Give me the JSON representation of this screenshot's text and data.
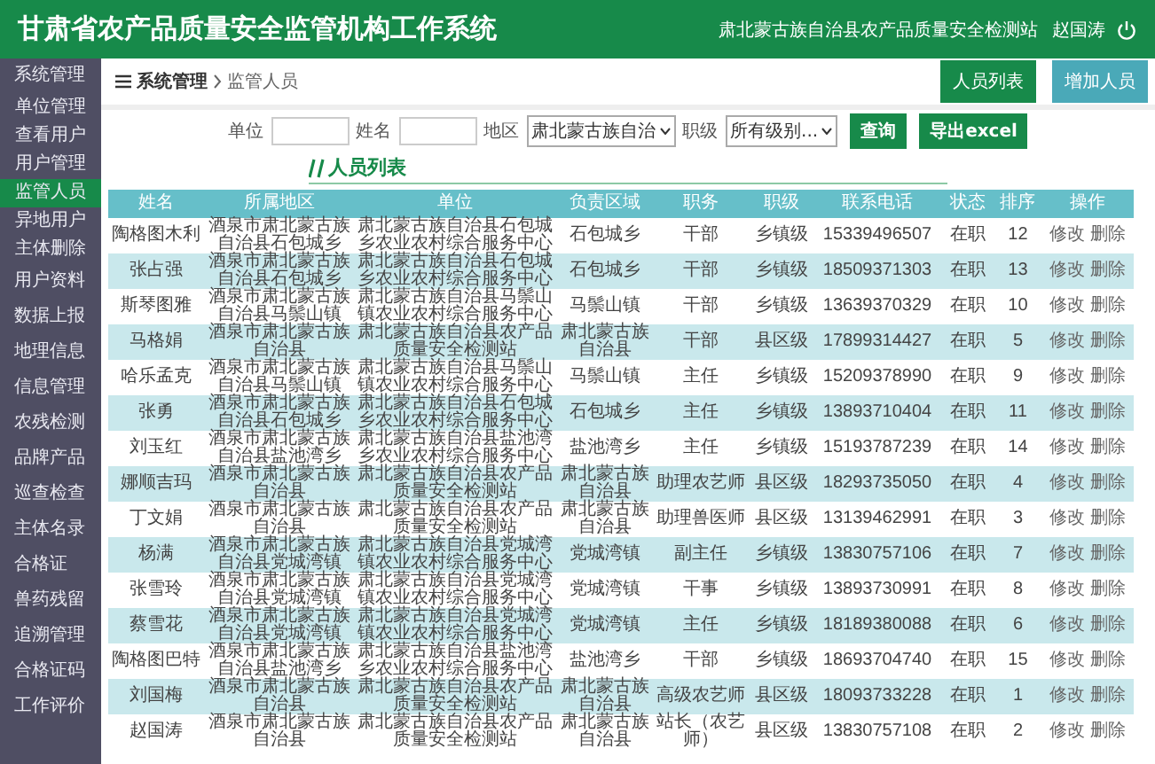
{
  "header": {
    "title": "甘肃省农产品质量安全监管机构工作系统",
    "org": "肃北蒙古族自治县农产品质量安全检测站",
    "user": "赵国涛"
  },
  "sidebar": {
    "items": [
      {
        "label": "系统管理",
        "kind": "group",
        "selected": false
      },
      {
        "label": "单位管理",
        "kind": "sub",
        "selected": false
      },
      {
        "label": "查看用户",
        "kind": "sub",
        "selected": false
      },
      {
        "label": "用户管理",
        "kind": "sub",
        "selected": false
      },
      {
        "label": "监管人员",
        "kind": "sub",
        "selected": true
      },
      {
        "label": "异地用户",
        "kind": "sub",
        "selected": false
      },
      {
        "label": "主体删除",
        "kind": "sub",
        "selected": false
      },
      {
        "label": "用户资料",
        "kind": "group",
        "selected": false
      },
      {
        "label": "数据上报",
        "kind": "group",
        "selected": false
      },
      {
        "label": "地理信息",
        "kind": "group",
        "selected": false
      },
      {
        "label": "信息管理",
        "kind": "group",
        "selected": false
      },
      {
        "label": "农残检测",
        "kind": "group",
        "selected": false
      },
      {
        "label": "品牌产品",
        "kind": "group",
        "selected": false
      },
      {
        "label": "巡查检查",
        "kind": "group",
        "selected": false
      },
      {
        "label": "主体名录",
        "kind": "group",
        "selected": false
      },
      {
        "label": "合格证",
        "kind": "group",
        "selected": false
      },
      {
        "label": "兽药残留",
        "kind": "group",
        "selected": false
      },
      {
        "label": "追溯管理",
        "kind": "group",
        "selected": false
      },
      {
        "label": "合格证码",
        "kind": "group",
        "selected": false
      },
      {
        "label": "工作评价",
        "kind": "group",
        "selected": false
      }
    ]
  },
  "breadcrumb": [
    "系统管理",
    "监管人员"
  ],
  "buttons": [
    {
      "label": "人员列表",
      "kind": "primary"
    },
    {
      "label": "增加人员",
      "kind": "secondary"
    }
  ],
  "filter": {
    "fields": [
      {
        "label": "单位",
        "kind": "input"
      },
      {
        "label": "姓名",
        "kind": "input"
      },
      {
        "label": "地区",
        "kind": "select",
        "value": "肃北蒙古族自治"
      },
      {
        "label": "职级",
        "kind": "select",
        "value": "所有级别..."
      }
    ],
    "buttons": [
      "查询",
      "导出excel"
    ]
  },
  "section_title": "人员列表",
  "table": {
    "columns": [
      "姓名",
      "所属地区",
      "单位",
      "负责区域",
      "职务",
      "职级",
      "联系电话",
      "状态",
      "排序",
      "操作"
    ],
    "rows": [
      {
        "cells": [
          "陶格图木利",
          "酒泉市肃北蒙古族自治县石包城乡",
          "肃北蒙古族自治县石包城乡农业农村综合服务中心",
          "石包城乡",
          "干部",
          "乡镇级",
          "15339496507",
          "在职",
          "12"
        ],
        "actions": [
          "修改",
          "删除"
        ]
      },
      {
        "cells": [
          "张占强",
          "酒泉市肃北蒙古族自治县石包城乡",
          "肃北蒙古族自治县石包城乡农业农村综合服务中心",
          "石包城乡",
          "干部",
          "乡镇级",
          "18509371303",
          "在职",
          "13"
        ],
        "actions": [
          "修改",
          "删除"
        ]
      },
      {
        "cells": [
          "斯琴图雅",
          "酒泉市肃北蒙古族自治县马鬃山镇",
          "肃北蒙古族自治县马鬃山镇农业农村综合服务中心",
          "马鬃山镇",
          "干部",
          "乡镇级",
          "13639370329",
          "在职",
          "10"
        ],
        "actions": [
          "修改",
          "删除"
        ]
      },
      {
        "cells": [
          "马格娟",
          "酒泉市肃北蒙古族自治县",
          "肃北蒙古族自治县农产品质量安全检测站",
          "肃北蒙古族自治县",
          "干部",
          "县区级",
          "17899314427",
          "在职",
          "5"
        ],
        "actions": [
          "修改",
          "删除"
        ]
      },
      {
        "cells": [
          "哈乐孟克",
          "酒泉市肃北蒙古族自治县马鬃山镇",
          "肃北蒙古族自治县马鬃山镇农业农村综合服务中心",
          "马鬃山镇",
          "主任",
          "乡镇级",
          "15209378990",
          "在职",
          "9"
        ],
        "actions": [
          "修改",
          "删除"
        ]
      },
      {
        "cells": [
          "张勇",
          "酒泉市肃北蒙古族自治县石包城乡",
          "肃北蒙古族自治县石包城乡农业农村综合服务中心",
          "石包城乡",
          "主任",
          "乡镇级",
          "13893710404",
          "在职",
          "11"
        ],
        "actions": [
          "修改",
          "删除"
        ]
      },
      {
        "cells": [
          "刘玉红",
          "酒泉市肃北蒙古族自治县盐池湾乡",
          "肃北蒙古族自治县盐池湾乡农业农村综合服务中心",
          "盐池湾乡",
          "主任",
          "乡镇级",
          "15193787239",
          "在职",
          "14"
        ],
        "actions": [
          "修改",
          "删除"
        ]
      },
      {
        "cells": [
          "娜顺吉玛",
          "酒泉市肃北蒙古族自治县",
          "肃北蒙古族自治县农产品质量安全检测站",
          "肃北蒙古族自治县",
          "助理农艺师",
          "县区级",
          "18293735050",
          "在职",
          "4"
        ],
        "actions": [
          "修改",
          "删除"
        ]
      },
      {
        "cells": [
          "丁文娟",
          "酒泉市肃北蒙古族自治县",
          "肃北蒙古族自治县农产品质量安全检测站",
          "肃北蒙古族自治县",
          "助理兽医师",
          "县区级",
          "13139462991",
          "在职",
          "3"
        ],
        "actions": [
          "修改",
          "删除"
        ]
      },
      {
        "cells": [
          "杨满",
          "酒泉市肃北蒙古族自治县党城湾镇",
          "肃北蒙古族自治县党城湾镇农业农村综合服务中心",
          "党城湾镇",
          "副主任",
          "乡镇级",
          "13830757106",
          "在职",
          "7"
        ],
        "actions": [
          "修改",
          "删除"
        ]
      },
      {
        "cells": [
          "张雪玲",
          "酒泉市肃北蒙古族自治县党城湾镇",
          "肃北蒙古族自治县党城湾镇农业农村综合服务中心",
          "党城湾镇",
          "干事",
          "乡镇级",
          "13893730991",
          "在职",
          "8"
        ],
        "actions": [
          "修改",
          "删除"
        ]
      },
      {
        "cells": [
          "蔡雪花",
          "酒泉市肃北蒙古族自治县党城湾镇",
          "肃北蒙古族自治县党城湾镇农业农村综合服务中心",
          "党城湾镇",
          "主任",
          "乡镇级",
          "18189380088",
          "在职",
          "6"
        ],
        "actions": [
          "修改",
          "删除"
        ]
      },
      {
        "cells": [
          "陶格图巴特",
          "酒泉市肃北蒙古族自治县盐池湾乡",
          "肃北蒙古族自治县盐池湾乡农业农村综合服务中心",
          "盐池湾乡",
          "干部",
          "乡镇级",
          "18693704740",
          "在职",
          "15"
        ],
        "actions": [
          "修改",
          "删除"
        ]
      },
      {
        "cells": [
          "刘国梅",
          "酒泉市肃北蒙古族自治县",
          "肃北蒙古族自治县农产品质量安全检测站",
          "肃北蒙古族自治县",
          "高级农艺师",
          "县区级",
          "18093733228",
          "在职",
          "1"
        ],
        "actions": [
          "修改",
          "删除"
        ]
      },
      {
        "cells": [
          "赵国涛",
          "酒泉市肃北蒙古族自治县",
          "肃北蒙古族自治县农产品质量安全检测站",
          "肃北蒙古族自治县",
          "站长（农艺师）",
          "县区级",
          "13830757108",
          "在职",
          "2"
        ],
        "actions": [
          "修改",
          "删除"
        ]
      }
    ]
  }
}
